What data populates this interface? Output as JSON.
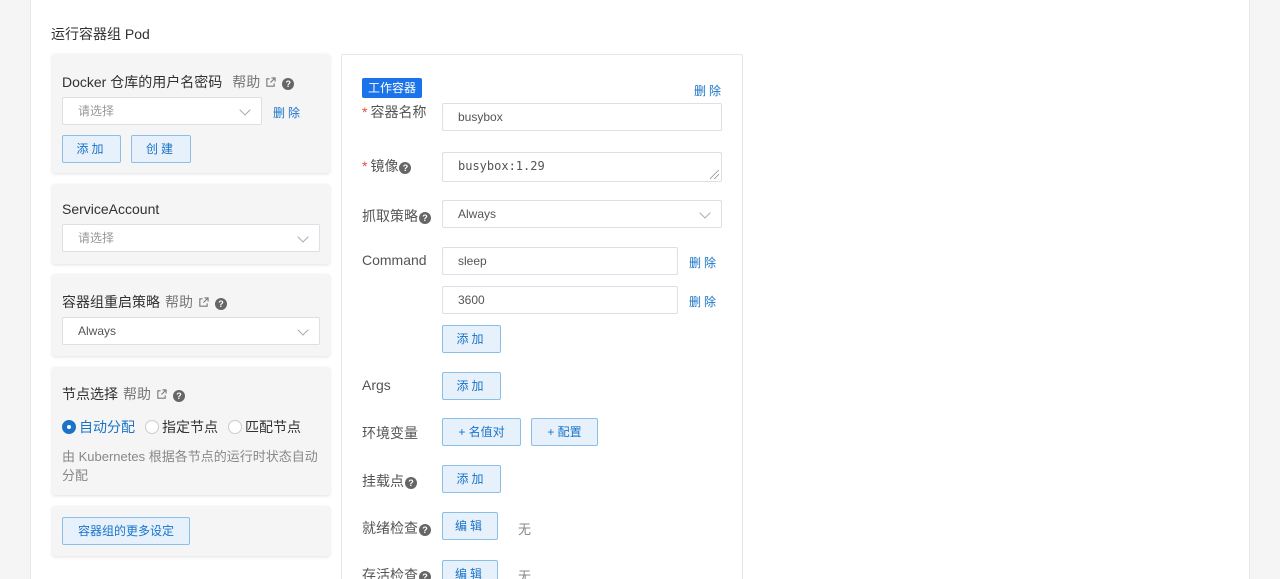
{
  "section_title": "运行容器组 Pod",
  "help_label": "帮助",
  "docker_card": {
    "title": "Docker 仓库的用户名密码",
    "select_placeholder": "请选择",
    "delete_label": "删除",
    "add_label": "添加",
    "create_label": "创建"
  },
  "service_account_card": {
    "title": "ServiceAccount",
    "select_placeholder": "请选择"
  },
  "restart_card": {
    "title": "容器组重启策略",
    "select_value": "Always"
  },
  "node_card": {
    "title": "节点选择",
    "options": [
      "自动分配",
      "指定节点",
      "匹配节点"
    ],
    "selected": "自动分配",
    "hint": "由 Kubernetes 根据各节点的运行时状态自动分配"
  },
  "more_settings_label": "容器组的更多设定",
  "container": {
    "tag": "工作容器",
    "delete_label": "删除",
    "name_label": "容器名称",
    "name_value": "busybox",
    "image_label": "镜像",
    "image_value": "busybox:1.29",
    "pull_label": "抓取策略",
    "pull_value": "Always",
    "command_label": "Command",
    "commands": [
      "sleep",
      "3600"
    ],
    "add_label": "添加",
    "args_label": "Args",
    "env_label": "环境变量",
    "env_pair_label": "+ 名值对",
    "env_config_label": "+ 配置",
    "mount_label": "挂载点",
    "readiness_label": "就绪检查",
    "liveness_label": "存活检查",
    "edit_label": "编辑",
    "none_text": "无"
  }
}
